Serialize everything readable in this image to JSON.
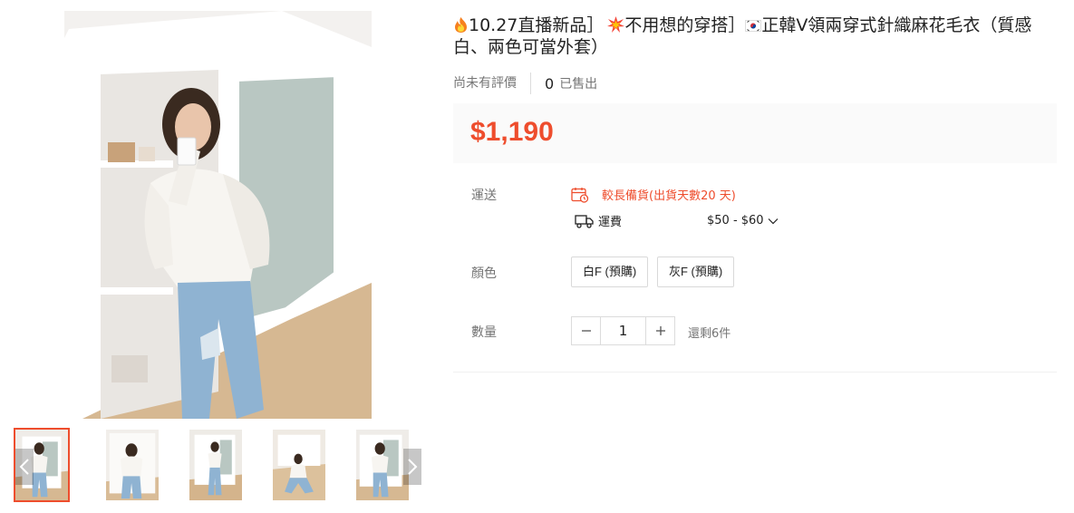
{
  "product": {
    "title_part1": "10.27直播新品］",
    "title_part2": "不用想的穿搭］",
    "title_part3": "正韓V領兩穿式針織麻花毛衣（質感白、兩色可當外套）",
    "review_status": "尚未有評價",
    "sold_count": "0",
    "sold_label": "已售出",
    "price": "$1,190"
  },
  "gallery": {
    "active_index": 0,
    "thumbnail_count": 5
  },
  "shipping": {
    "label": "運送",
    "lead_time_text": "較長備貨(出貨天數20 天)",
    "fee_label": "運費",
    "fee_range": "$50 - $60"
  },
  "color": {
    "label": "顏色",
    "options": [
      "白F (預購)",
      "灰F (預購)"
    ]
  },
  "quantity": {
    "label": "數量",
    "value": "1",
    "stock_text": "還剩6件"
  },
  "colors": {
    "accent": "#ee4d2d",
    "price_bg": "#fafafa",
    "muted_text": "#757575"
  },
  "icons": [
    "fire-emoji",
    "boom-emoji",
    "korea-flag-emoji",
    "calendar-clock-icon",
    "truck-icon",
    "chevron-down-icon",
    "minus-icon",
    "plus-icon",
    "chevron-left-icon",
    "chevron-right-icon"
  ]
}
